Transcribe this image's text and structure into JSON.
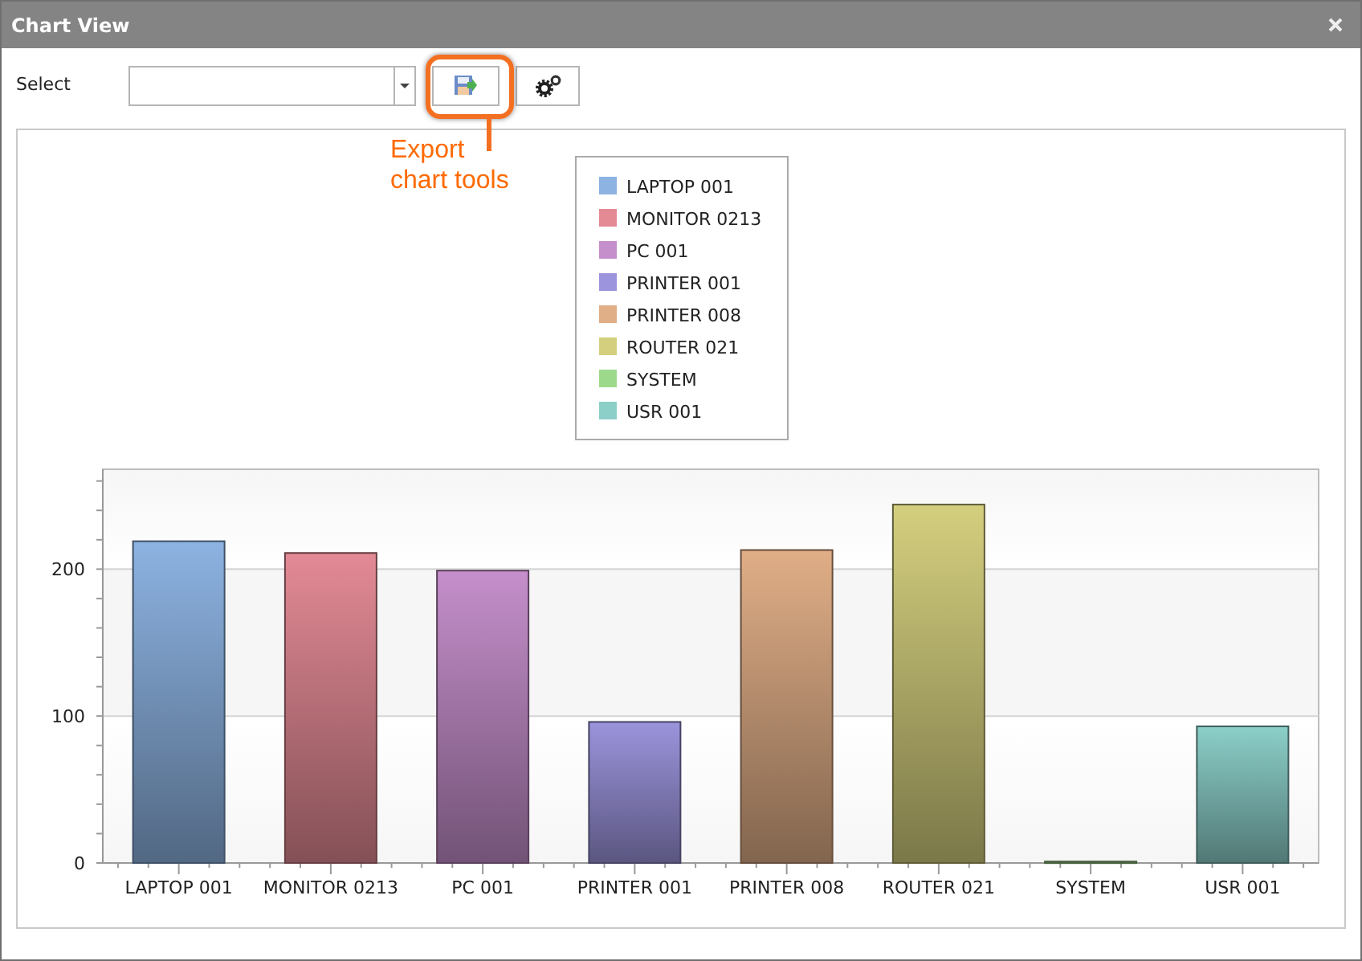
{
  "window": {
    "title": "Chart View"
  },
  "toolbar": {
    "select_label": "Select"
  },
  "callout": {
    "text": "Export chart tools"
  },
  "chart": {
    "legend": [
      {
        "label": "LAPTOP 001",
        "color": "#8db3e2"
      },
      {
        "label": "MONITOR 0213",
        "color": "#e38a95"
      },
      {
        "label": "PC 001",
        "color": "#c58fcb"
      },
      {
        "label": "PRINTER 001",
        "color": "#9c94dc"
      },
      {
        "label": "PRINTER 008",
        "color": "#e0ae87"
      },
      {
        "label": "ROUTER 021",
        "color": "#d4cf7e"
      },
      {
        "label": "SYSTEM",
        "color": "#9dd98a"
      },
      {
        "label": "USR 001",
        "color": "#8ccfc9"
      }
    ],
    "chart_data": {
      "type": "bar",
      "categories": [
        "LAPTOP 001",
        "MONITOR 0213",
        "PC 001",
        "PRINTER 001",
        "PRINTER 008",
        "ROUTER 021",
        "SYSTEM",
        "USR 001"
      ],
      "values": [
        219,
        211,
        199,
        96,
        213,
        244,
        1,
        93
      ],
      "ylim": [
        0,
        268
      ],
      "yticks": [
        0,
        100,
        200
      ]
    }
  }
}
